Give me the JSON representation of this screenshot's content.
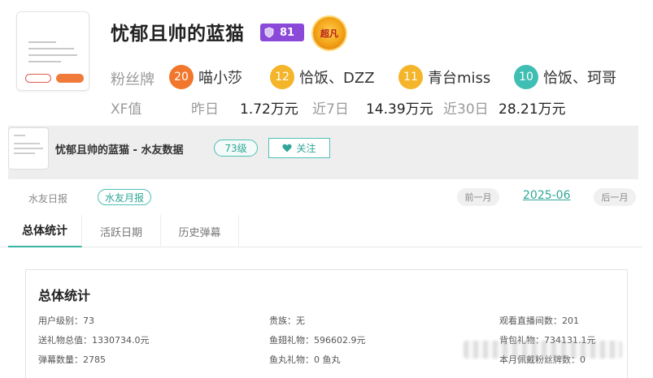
{
  "profile": {
    "name": "忧郁且帅的蓝猫",
    "level": "81",
    "noble": "超凡"
  },
  "fan_row": {
    "label": "粉丝牌",
    "badges": [
      {
        "level": "20",
        "name": "喵小莎",
        "color": "#f2772d"
      },
      {
        "level": "12",
        "name": "恰饭、DZZ",
        "color": "#f5b52a"
      },
      {
        "level": "11",
        "name": "青台miss",
        "color": "#f5b52a"
      },
      {
        "level": "10",
        "name": "恰饭、珂哥",
        "color": "#3fbfb3"
      }
    ]
  },
  "xf_row": {
    "label": "XF值",
    "yesterday_label": "昨日",
    "yesterday_value": "1.72万元",
    "week_label": "近7日",
    "week_value": "14.39万元",
    "month_label": "近30日",
    "month_value": "28.21万元"
  },
  "strip": {
    "title": "忧郁且帅的蓝猫 - 水友数据",
    "level_pill": "73级",
    "follow_label": "关注"
  },
  "report_switch": {
    "daily": "水友日报",
    "monthly": "水友月报",
    "prev": "前一月",
    "month": "2025-06",
    "next": "后一月"
  },
  "tabs": [
    "总体统计",
    "活跃日期",
    "历史弹幕"
  ],
  "stats_card": {
    "title": "总体统计",
    "items": [
      {
        "key": "用户级别：",
        "value": "73"
      },
      {
        "key": "贵族：",
        "value": "无"
      },
      {
        "key": "观看直播间数：",
        "value": "201"
      },
      {
        "key": "送礼物总值：",
        "value": "1330734.0元"
      },
      {
        "key": "鱼翅礼物：",
        "value": "596602.9元"
      },
      {
        "key": "背包礼物：",
        "value": "734131.1元"
      },
      {
        "key": "弹幕数量：",
        "value": "2785"
      },
      {
        "key": "鱼丸礼物：",
        "value": "0 鱼丸"
      },
      {
        "key": "本月佩戴粉丝牌数：",
        "value": "0"
      }
    ]
  }
}
